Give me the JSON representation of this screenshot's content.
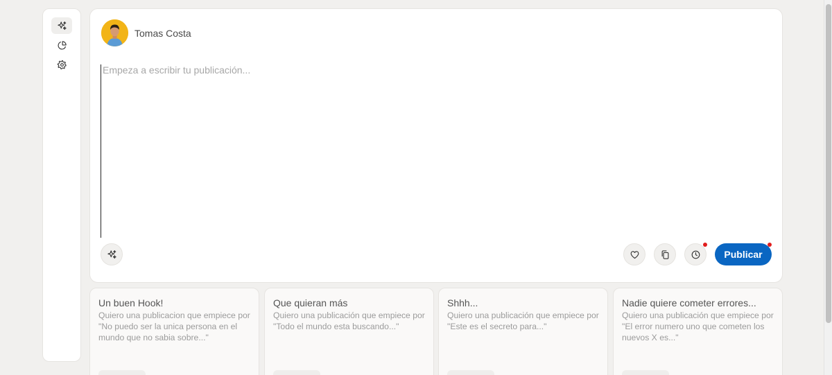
{
  "sidebar": {
    "items": [
      {
        "icon": "sparkles-icon",
        "name": "sidebar-item-generate"
      },
      {
        "icon": "pie-chart-icon",
        "name": "sidebar-item-analytics"
      },
      {
        "icon": "gear-icon",
        "name": "sidebar-item-settings"
      }
    ]
  },
  "editor": {
    "user_name": "Tomas Costa",
    "placeholder": "Empeza a escribir tu publicación...",
    "publish_label": "Publicar"
  },
  "templates": [
    {
      "title": "Un buen Hook!",
      "description": "Quiero una publicacion que empiece por \"No puedo ser la unica persona en el mundo que no sabia sobre...\""
    },
    {
      "title": "Que quieran más",
      "description": "Quiero una publicación que empiece por \"Todo el mundo esta buscando...\""
    },
    {
      "title": "Shhh...",
      "description": "Quiero una publicación que empiece por \"Este es el secreto para...\""
    },
    {
      "title": "Nadie quiere cometer errores...",
      "description": "Quiero una publicación que empiece por \"El error numero uno que cometen los nuevos X es...\""
    }
  ],
  "colors": {
    "accent": "#0a66c2",
    "notification_dot": "#e11d1d",
    "avatar_bg": "#f2b417"
  }
}
